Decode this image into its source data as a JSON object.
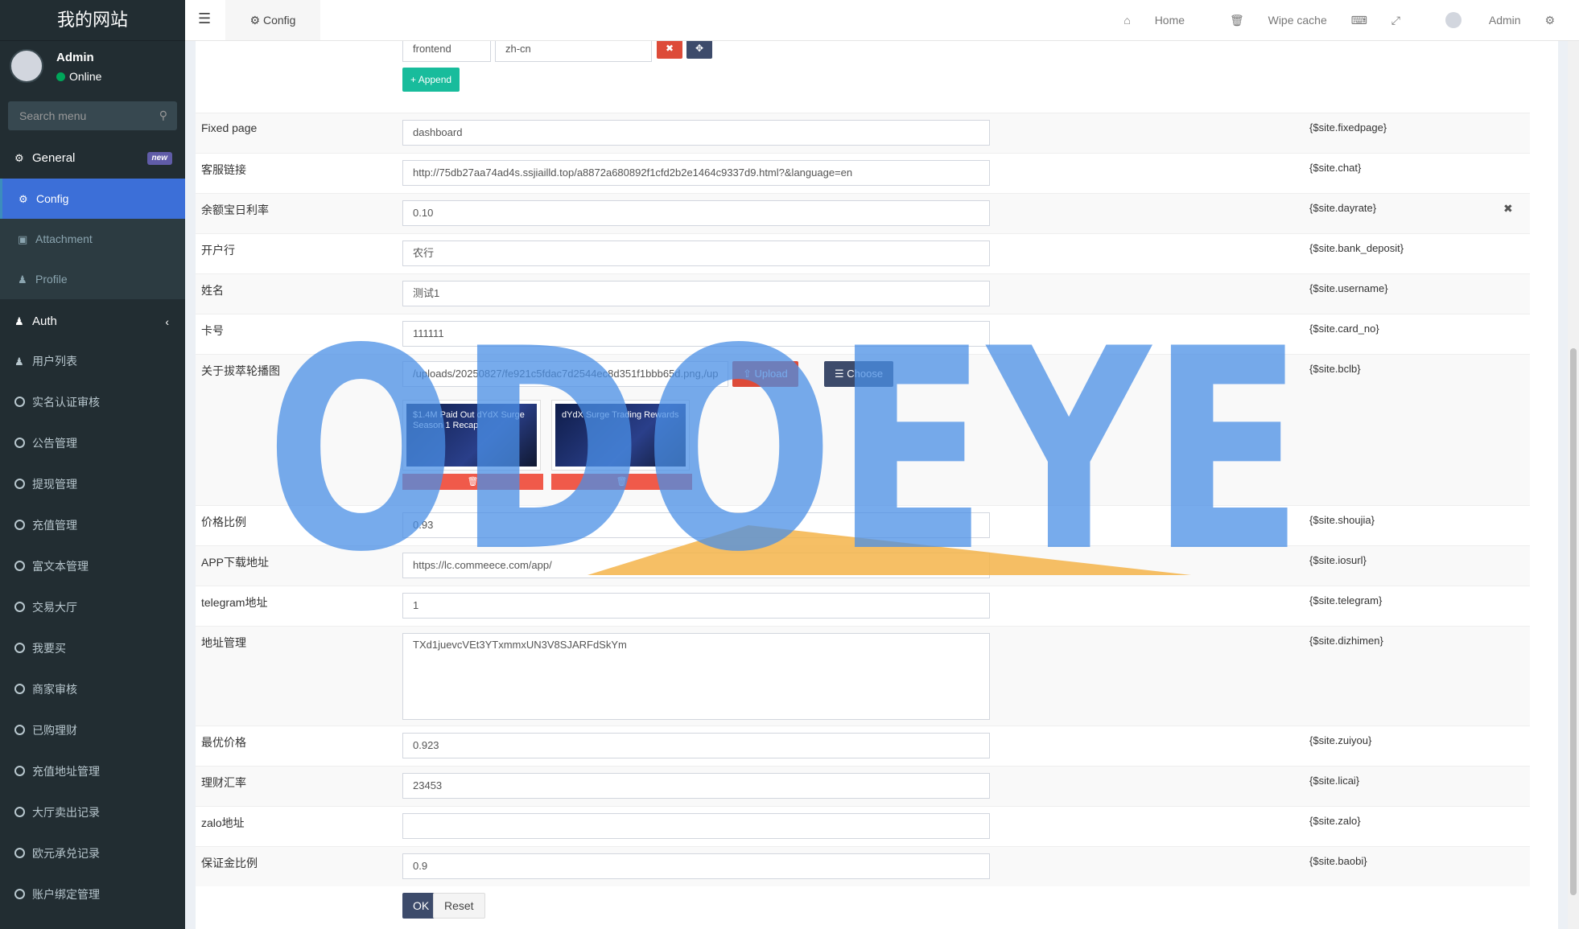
{
  "sidebar": {
    "logo": "我的网站",
    "user": {
      "name": "Admin",
      "status": "Online"
    },
    "search_placeholder": "Search menu",
    "general": {
      "label": "General",
      "badge": "new"
    },
    "general_items": [
      {
        "label": "Config",
        "icon": "gear-icon"
      },
      {
        "label": "Attachment",
        "icon": "image-icon"
      },
      {
        "label": "Profile",
        "icon": "user-icon"
      }
    ],
    "auth": {
      "label": "Auth"
    },
    "auth_items": [
      "用户列表",
      "实名认证审核",
      "公告管理",
      "提现管理",
      "充值管理",
      "富文本管理",
      "交易大厅",
      "我要买",
      "商家审核",
      "已购理财",
      "充值地址管理",
      "大厅卖出记录",
      "欧元承兑记录",
      "账户绑定管理"
    ]
  },
  "topbar": {
    "tab": "Config",
    "home": "Home",
    "wipe": "Wipe cache",
    "admin": "Admin"
  },
  "top_kv": {
    "key": "frontend",
    "value": "zh-cn",
    "append": "Append"
  },
  "rows": [
    {
      "label": "Fixed page",
      "value": "dashboard",
      "var": "{$site.fixedpage}"
    },
    {
      "label": "客服链接",
      "value": "http://75db27aa74ad4s.ssjiailld.top/a8872a680892f1cfd2b2e1464c9337d9.html?&language=en",
      "var": "{$site.chat}"
    },
    {
      "label": "余额宝日利率",
      "value": "0.10",
      "var": "{$site.dayrate}"
    },
    {
      "label": "开户行",
      "value": "农行",
      "var": "{$site.bank_deposit}"
    },
    {
      "label": "姓名",
      "value": "测试1",
      "var": "{$site.username}"
    },
    {
      "label": "卡号",
      "value": "111111",
      "var": "{$site.card_no}"
    },
    {
      "label": "关于拔萃轮播图",
      "value": "/uploads/20250827/fe921c5fdac7d2544ec8d351f1bbb65d.png,/up",
      "var": "{$site.bclb}"
    },
    {
      "label": "价格比例",
      "value": "0.93",
      "var": "{$site.shoujia}"
    },
    {
      "label": "APP下载地址",
      "value": "https://lc.commeece.com/app/",
      "var": "{$site.iosurl}"
    },
    {
      "label": "telegram地址",
      "value": "1",
      "var": "{$site.telegram}"
    },
    {
      "label": "地址管理",
      "value": "TXd1juevcVEt3YTxmmxUN3V8SJARFdSkYm",
      "var": "{$site.dizhimen}"
    },
    {
      "label": "最优价格",
      "value": "0.923",
      "var": "{$site.zuiyou}"
    },
    {
      "label": "理财汇率",
      "value": "23453",
      "var": "{$site.licai}"
    },
    {
      "label": "zalo地址",
      "value": "",
      "var": "{$site.zalo}"
    },
    {
      "label": "保证金比例",
      "value": "0.9",
      "var": "{$site.baobi}"
    }
  ],
  "upload": {
    "upload": "Upload",
    "choose": "Choose"
  },
  "thumbs": [
    {
      "text": "$1.4M Paid Out dYdX Surge Season 1 Recap"
    },
    {
      "text": "dYdX Surge Trading Rewards"
    }
  ],
  "buttons": {
    "ok": "OK",
    "reset": "Reset"
  },
  "watermark": "ODOEYE",
  "colors": {
    "sidebar_bg": "#222d32",
    "active": "#3c6fd8",
    "append": "#18bc9c",
    "danger": "#dd4b39",
    "primary": "#3d4b6b",
    "watermark": "#4a8fe6"
  }
}
